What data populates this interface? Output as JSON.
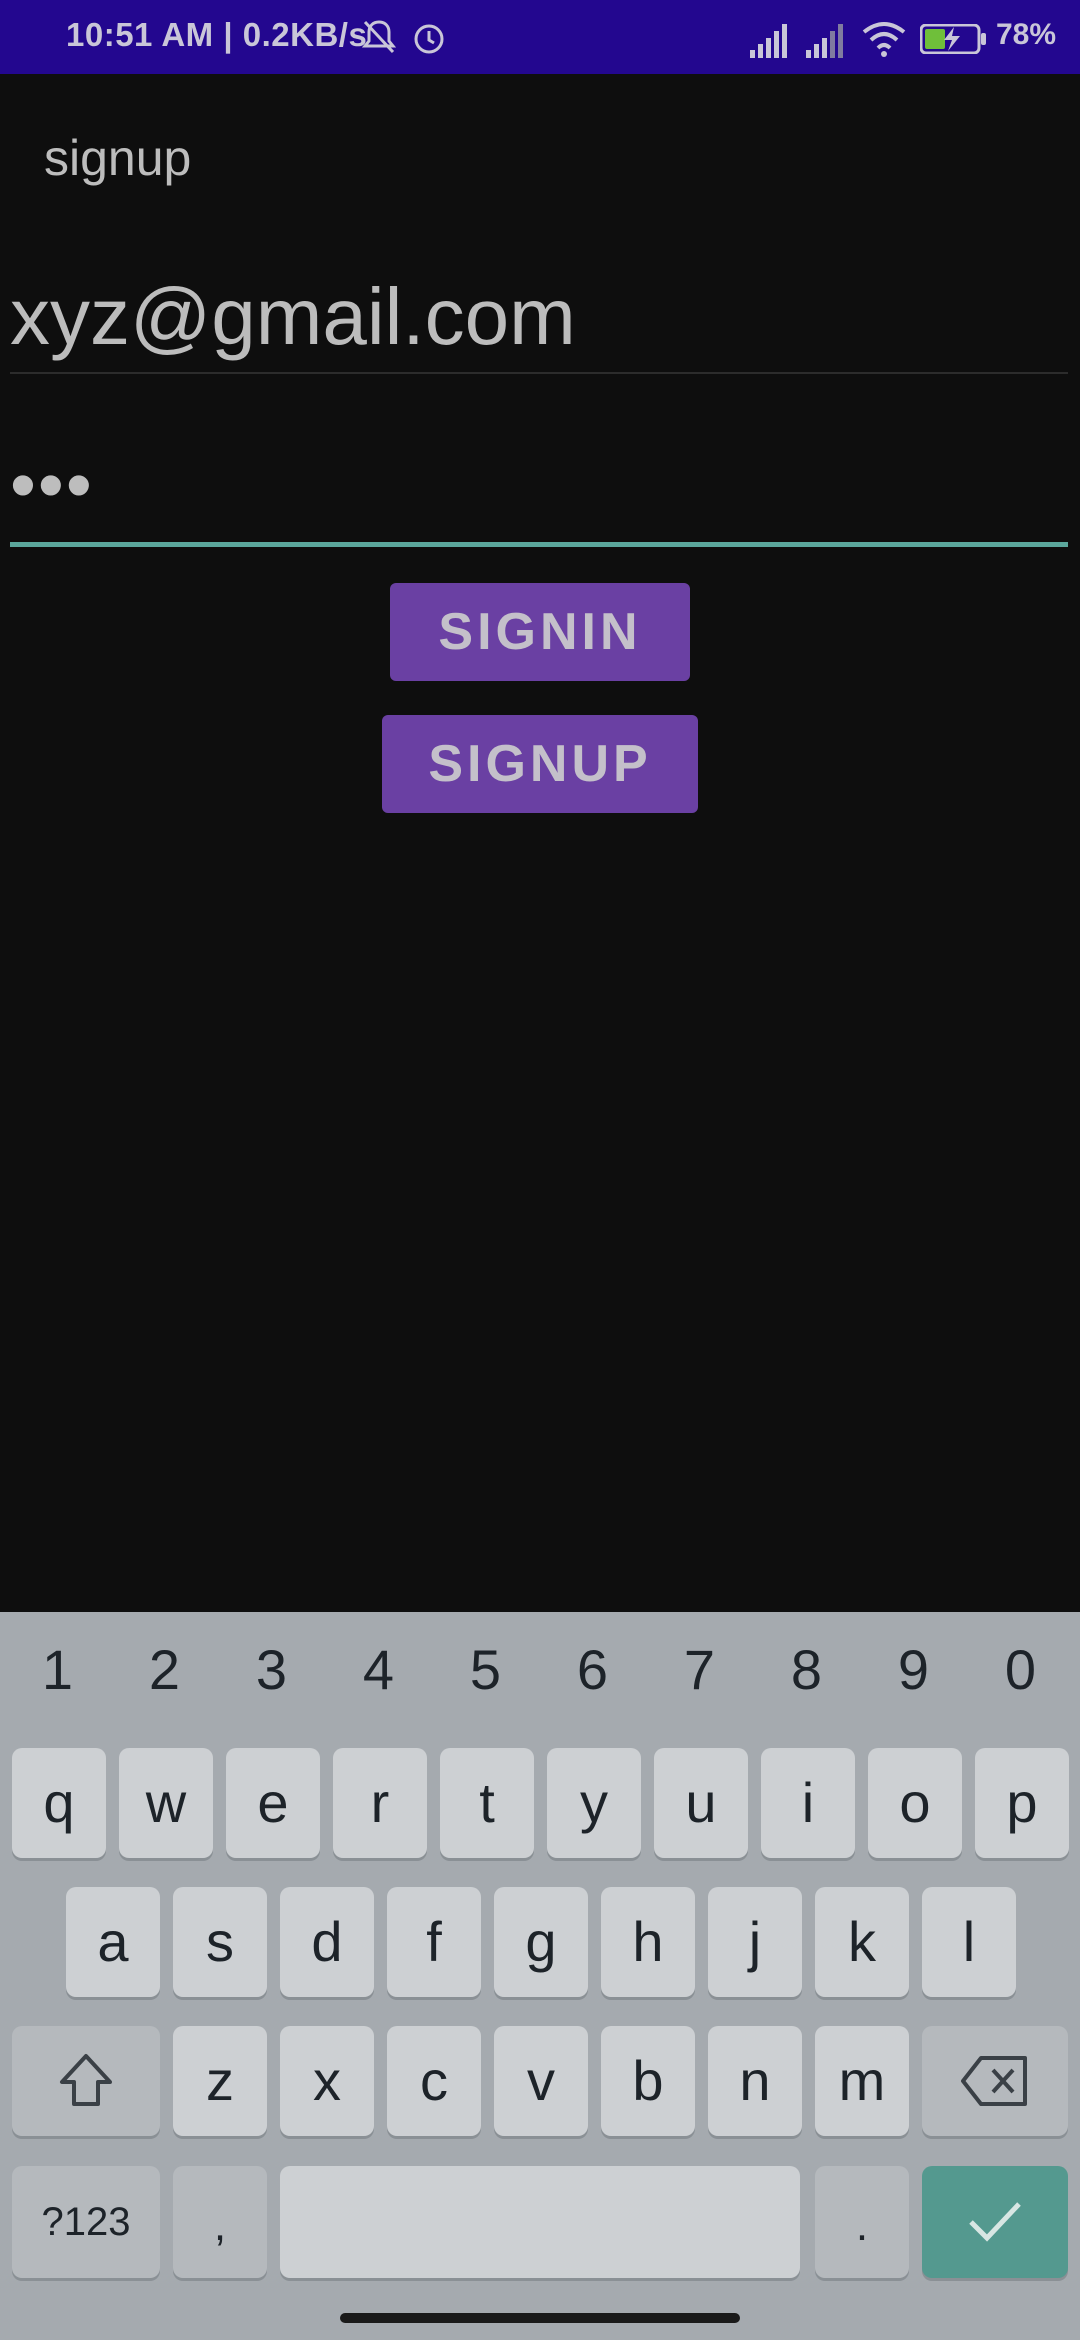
{
  "status_bar": {
    "time_speed": "10:51 AM | 0.2KB/s",
    "battery_percent": "78%",
    "icons": [
      "mute-bell-icon",
      "alarm-icon",
      "cell-signal-icon",
      "cell-signal-icon",
      "wifi-icon",
      "battery-charging-icon"
    ]
  },
  "app": {
    "title": "signup"
  },
  "form": {
    "email_value": "xyz@gmail.com",
    "password_value": "•••",
    "signin_label": "SIGNIN",
    "signup_label": "SIGNUP"
  },
  "keyboard": {
    "numbers": [
      "1",
      "2",
      "3",
      "4",
      "5",
      "6",
      "7",
      "8",
      "9",
      "0"
    ],
    "row1": [
      "q",
      "w",
      "e",
      "r",
      "t",
      "y",
      "u",
      "i",
      "o",
      "p"
    ],
    "row2": [
      "a",
      "s",
      "d",
      "f",
      "g",
      "h",
      "j",
      "k",
      "l"
    ],
    "row3": [
      "z",
      "x",
      "c",
      "v",
      "b",
      "n",
      "m"
    ],
    "symbols_label": "?123",
    "comma_label": ",",
    "period_label": "."
  },
  "colors": {
    "status_bar": "#23078f",
    "button": "#6a40a3",
    "accent": "#5ba79c",
    "background": "#0e0e0e"
  }
}
